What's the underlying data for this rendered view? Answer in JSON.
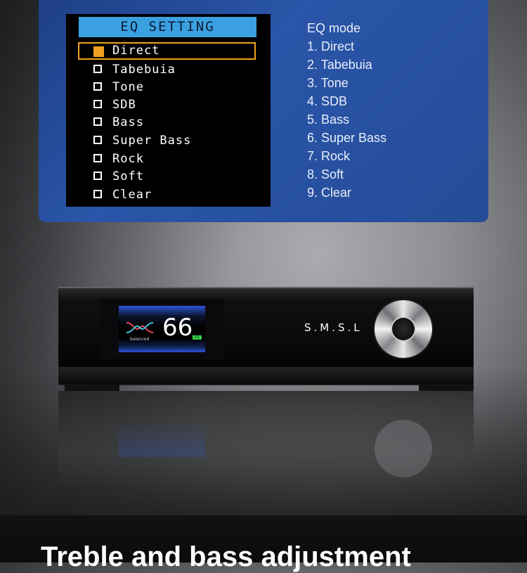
{
  "eq_screen": {
    "title": "EQ SETTING",
    "items": [
      {
        "label": "Direct",
        "selected": true
      },
      {
        "label": "Tabebuia",
        "selected": false
      },
      {
        "label": "Tone",
        "selected": false
      },
      {
        "label": "SDB",
        "selected": false
      },
      {
        "label": "Bass",
        "selected": false
      },
      {
        "label": "Super Bass",
        "selected": false
      },
      {
        "label": "Rock",
        "selected": false
      },
      {
        "label": "Soft",
        "selected": false
      },
      {
        "label": "Clear",
        "selected": false
      }
    ],
    "selection_color": "#f0a020",
    "title_bar_color": "#3ba0e0"
  },
  "mode_list": {
    "heading": "EQ mode",
    "lines": [
      "1. Direct",
      "2. Tabebuia",
      "3. Tone",
      "4. SDB",
      "5. Bass",
      "6. Super Bass",
      "7. Rock",
      "8. Soft",
      "9. Clear"
    ]
  },
  "device": {
    "volume": "66",
    "display_mode": "balanced",
    "volume_badge": "VOL",
    "brand": "S.M.S.L",
    "logo_icon": "wave-logo-icon"
  },
  "headline": "Treble and bass adjustment",
  "colors": {
    "panel": "#2a55a8",
    "display_accent": "#2c55d6",
    "badge": "#35d34a"
  }
}
